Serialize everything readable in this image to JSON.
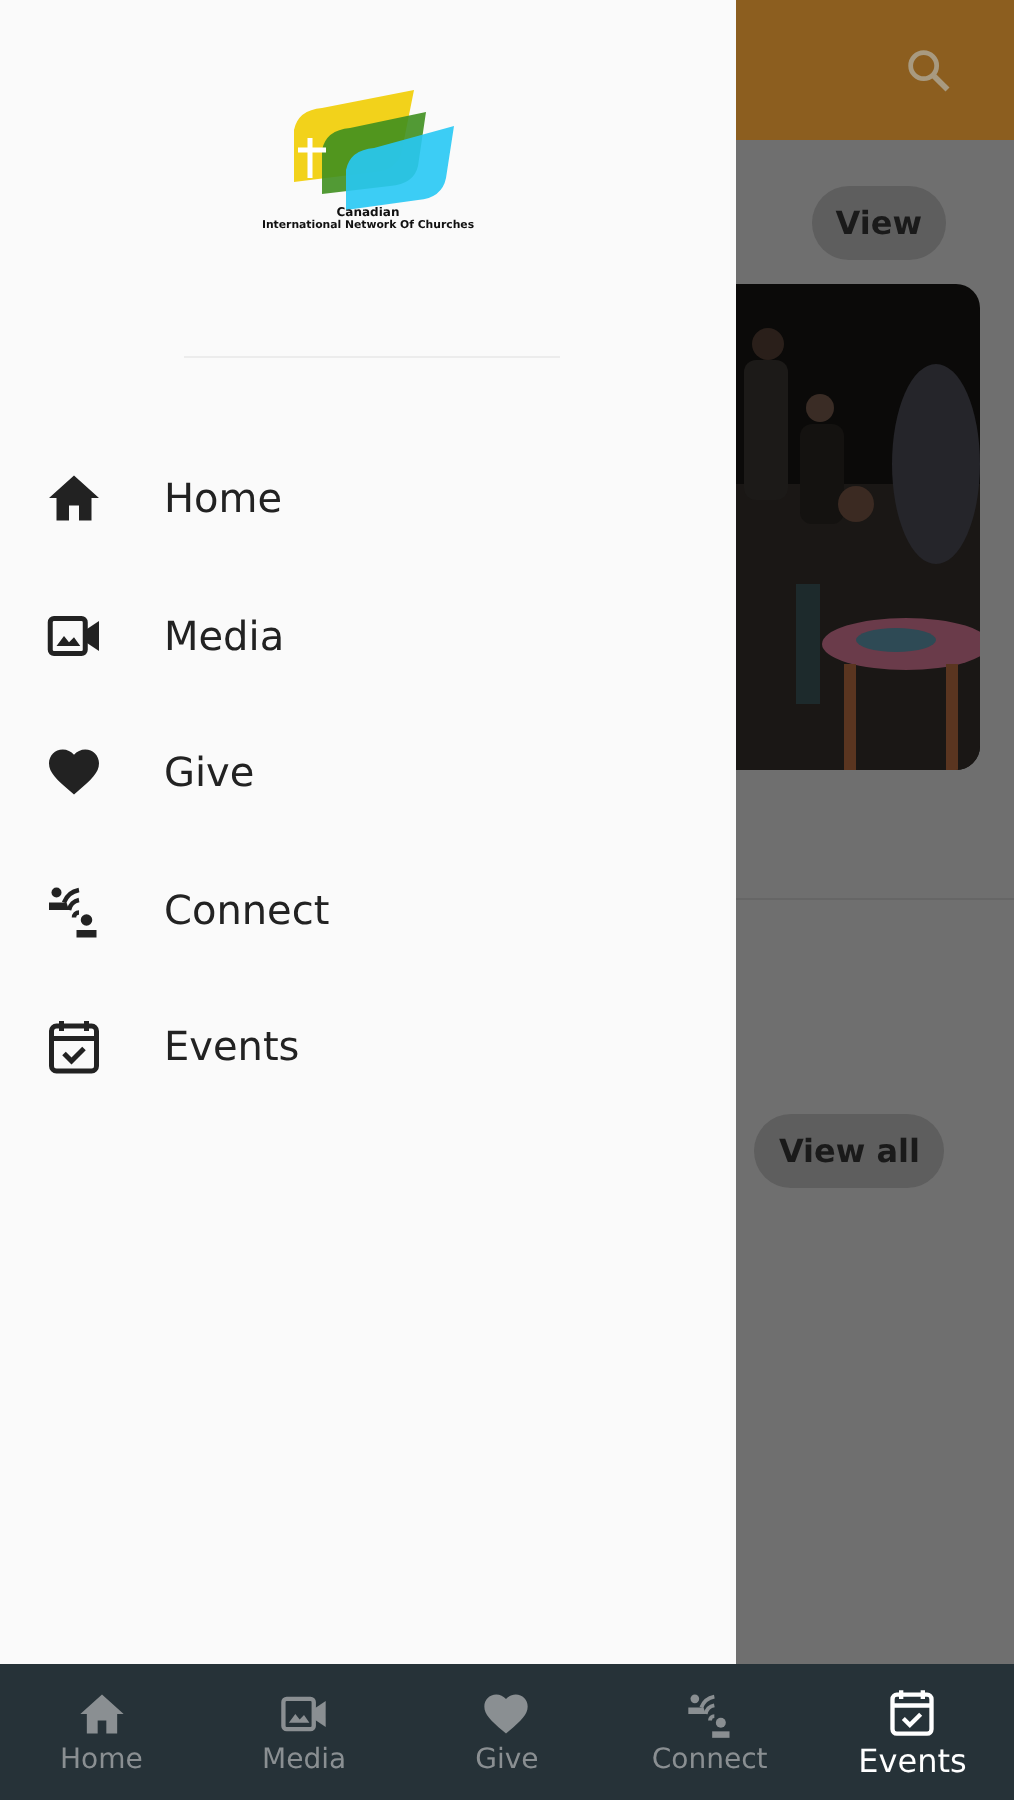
{
  "logo": {
    "line_1": "Canadian",
    "line_2": "International Network Of Churches"
  },
  "drawer": {
    "items": [
      {
        "label": "Home"
      },
      {
        "label": "Media"
      },
      {
        "label": "Give"
      },
      {
        "label": "Connect"
      },
      {
        "label": "Events"
      }
    ]
  },
  "background": {
    "view_button": "View",
    "view_all_button": "View all"
  },
  "bottom_nav": [
    {
      "label": "Home",
      "selected": false
    },
    {
      "label": "Media",
      "selected": false
    },
    {
      "label": "Give",
      "selected": false
    },
    {
      "label": "Connect",
      "selected": false
    },
    {
      "label": "Events",
      "selected": true
    }
  ]
}
